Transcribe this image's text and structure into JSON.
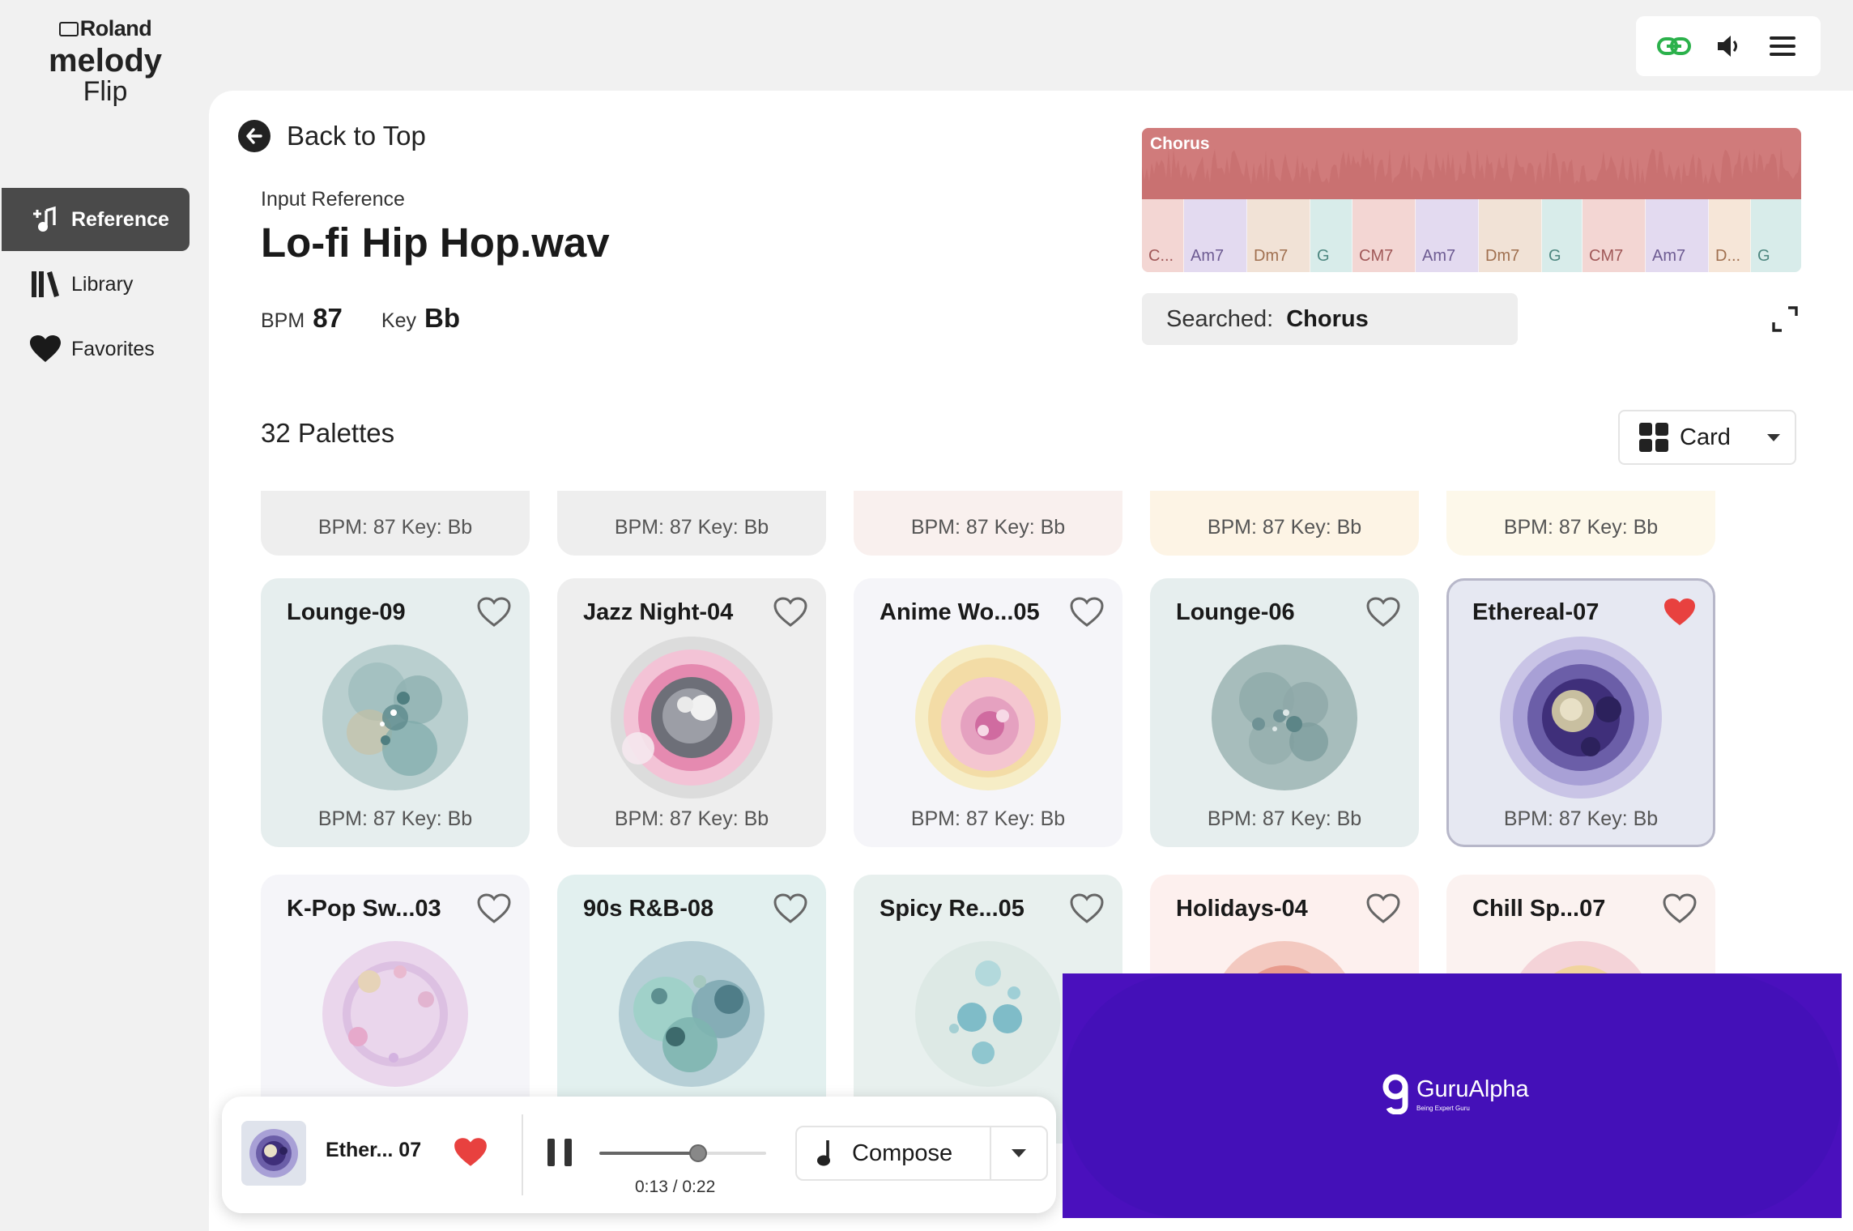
{
  "logo": {
    "brand": "Roland",
    "product_line1": "melody",
    "product_line2": "Flip"
  },
  "sidebar": {
    "items": [
      {
        "label": "Reference",
        "icon": "music-add-icon",
        "active": true
      },
      {
        "label": "Library",
        "icon": "library-icon",
        "active": false
      },
      {
        "label": "Favorites",
        "icon": "heart-icon",
        "active": false
      }
    ]
  },
  "toolbar": {
    "icons": [
      "link-icon",
      "speaker-icon",
      "menu-icon"
    ],
    "link_color": "#2bb14b"
  },
  "header": {
    "back_label": "Back to Top",
    "input_label": "Input Reference",
    "file_name": "Lo-fi Hip Hop.wav",
    "bpm_label": "BPM",
    "bpm_value": "87",
    "key_label": "Key",
    "key_value": "Bb"
  },
  "waveform": {
    "section_label": "Chorus",
    "chords": [
      "C...",
      "Am7",
      "Dm7",
      "G",
      "CM7",
      "Am7",
      "Dm7",
      "G",
      "CM7",
      "Am7",
      "D...",
      "G"
    ]
  },
  "search": {
    "label": "Searched:",
    "value": "Chorus"
  },
  "palettes": {
    "count_label": "32 Palettes",
    "view_label": "Card"
  },
  "cards": {
    "row0": [
      {
        "bpm": "BPM: 87  Key: Bb"
      },
      {
        "bpm": "BPM: 87  Key: Bb"
      },
      {
        "bpm": "BPM: 87  Key: Bb"
      },
      {
        "bpm": "BPM: 87  Key: Bb"
      },
      {
        "bpm": "BPM: 87  Key: Bb"
      }
    ],
    "row1": [
      {
        "title": "Lounge-09",
        "bpm": "BPM: 87  Key: Bb",
        "favorite": false
      },
      {
        "title": "Jazz Night-04",
        "bpm": "BPM: 87  Key: Bb",
        "favorite": false
      },
      {
        "title": "Anime Wo...05",
        "bpm": "BPM: 87  Key: Bb",
        "favorite": false
      },
      {
        "title": "Lounge-06",
        "bpm": "BPM: 87  Key: Bb",
        "favorite": false
      },
      {
        "title": "Ethereal-07",
        "bpm": "BPM: 87  Key: Bb",
        "favorite": true
      }
    ],
    "row2": [
      {
        "title": "K-Pop Sw...03",
        "favorite": false
      },
      {
        "title": "90s R&B-08",
        "favorite": false
      },
      {
        "title": "Spicy Re...05",
        "favorite": false
      },
      {
        "title": "Holidays-04",
        "favorite": false
      },
      {
        "title": "Chill Sp...07",
        "favorite": false
      }
    ]
  },
  "player": {
    "track": "Ether...  07",
    "favorite": true,
    "time": "0:13 / 0:22",
    "progress": 0.59,
    "compose_label": "Compose"
  },
  "ad": {
    "brand": "GuruAlpha",
    "tagline": "Being Expert Guru",
    "background": "#4410b8"
  },
  "colors": {
    "favorite_red": "#e8413f",
    "sidebar_active": "#4a4a4a"
  }
}
